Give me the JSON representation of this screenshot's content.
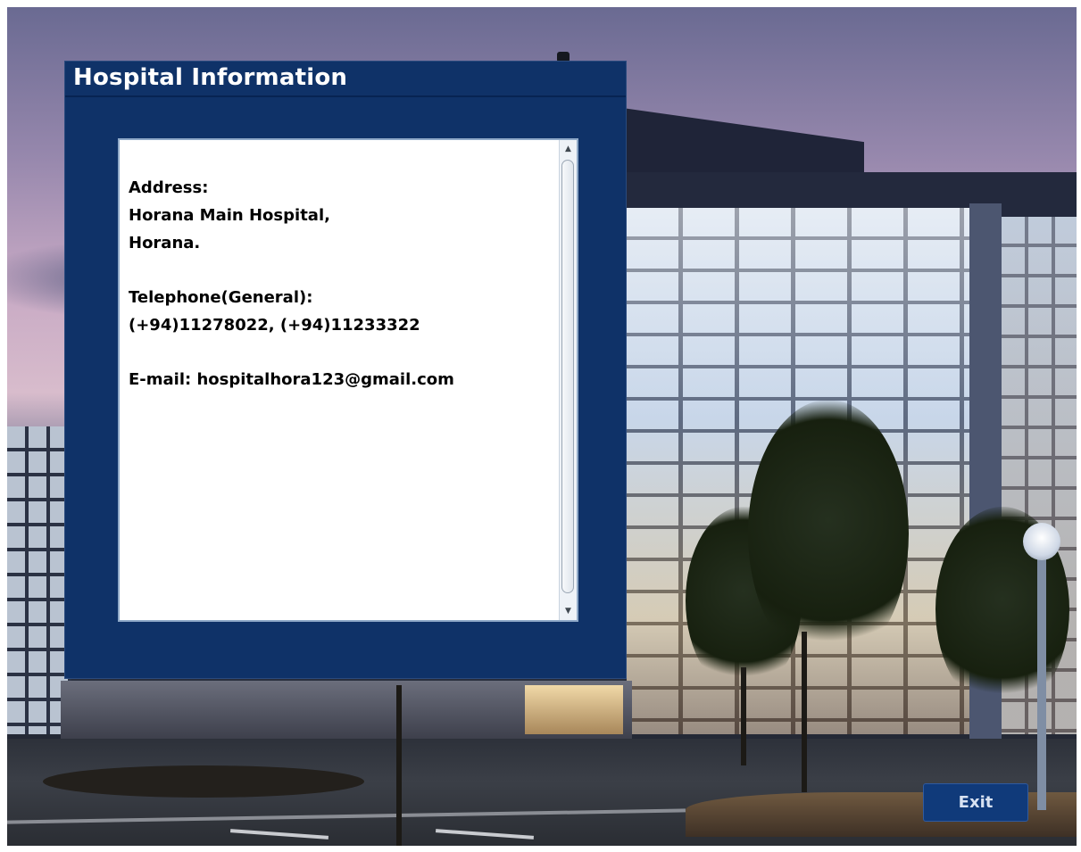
{
  "window": {
    "background": "night-photo-of-hospital-building"
  },
  "panel": {
    "title": "Hospital Information",
    "background_color": "#0f3268",
    "info": {
      "address_label": "Address:",
      "address_line1": "Horana Main Hospital,",
      "address_line2": "Horana.",
      "telephone_label": "Telephone(General):",
      "telephone_numbers": "(+94)11278022, (+94)11233322",
      "email": "E-mail: hospitalhora123@gmail.com"
    },
    "scrollbar": {
      "up_icon": "▲",
      "down_icon": "▼"
    }
  },
  "footer": {
    "exit_label": "Exit",
    "accent_color": "#103a7a"
  }
}
